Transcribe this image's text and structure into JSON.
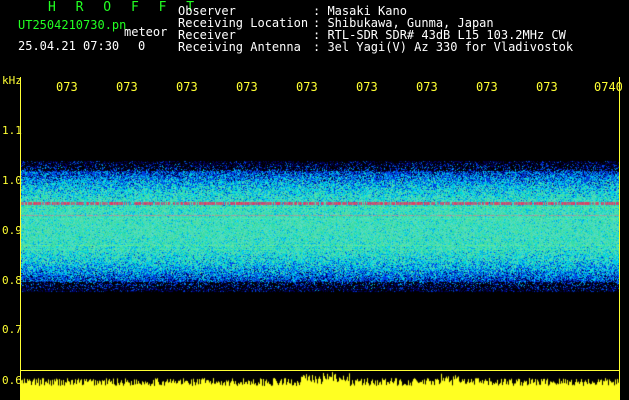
{
  "header": {
    "app_title": "H R O F F T",
    "file_name": "UT2504210730.pn",
    "meteor_label": "meteor",
    "date_time": "25.04.21 07:30",
    "meteor_count": "0"
  },
  "info": [
    {
      "label": "Observer",
      "value": ": Masaki Kano"
    },
    {
      "label": "Receiving Location",
      "value": ": Shibukawa, Gunma, Japan"
    },
    {
      "label": "Receiver",
      "value": ": RTL-SDR SDR# 43dB L15 103.2MHz CW"
    },
    {
      "label": "Receiving Antenna",
      "value": ": 3el Yagi(V) Az 330 for Vladivostok"
    }
  ],
  "y_axis": {
    "unit": "kHz",
    "ticks": [
      "1.1",
      "1.0",
      "0.9",
      "0.8",
      "0.7",
      "0.6"
    ]
  },
  "x_axis": {
    "ticks": [
      "073",
      "073",
      "073",
      "073",
      "073",
      "073",
      "073",
      "073",
      "073",
      "0740"
    ]
  },
  "colors": {
    "text_green": "#22ff22",
    "text_white": "#ffffff",
    "axis_yellow": "#ffff33",
    "signal_red": "#ff2255"
  }
}
